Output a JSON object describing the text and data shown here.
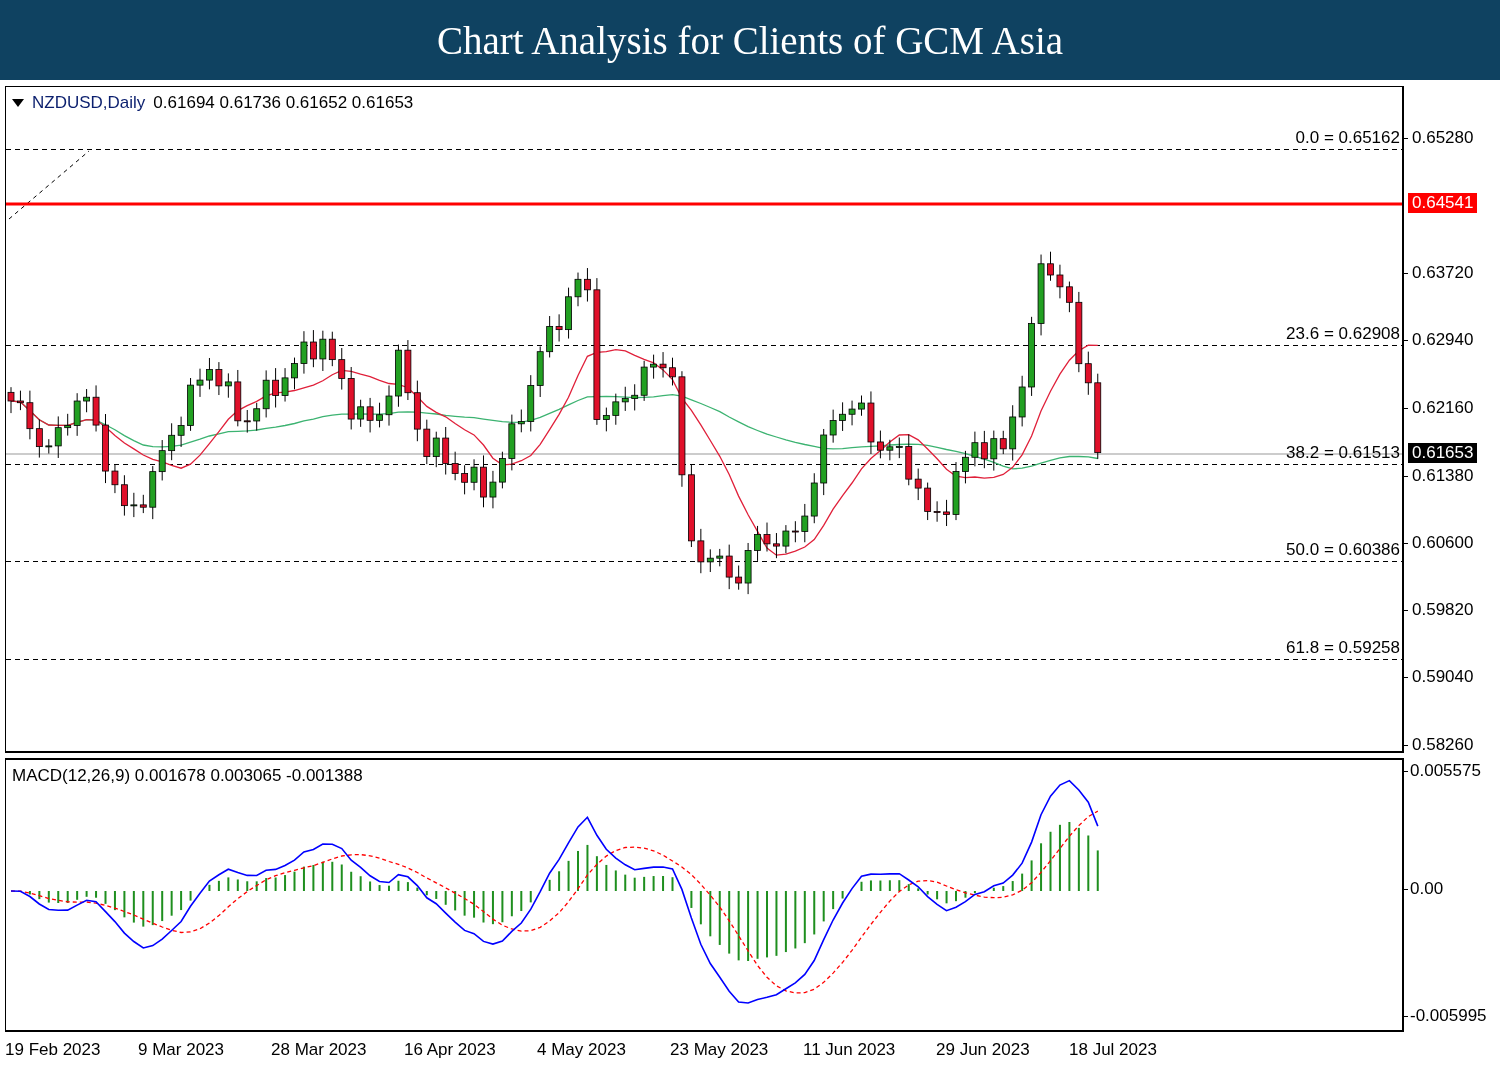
{
  "header": {
    "title": "Chart Analysis for Clients of GCM Asia"
  },
  "main_chart": {
    "symbol": "NZDUSD,Daily",
    "ohlc": "0.61694 0.61736 0.61652 0.61653",
    "fibonacci_levels": [
      {
        "label": "0.0 = 0.65162"
      },
      {
        "label": "23.6 = 0.62908"
      },
      {
        "label": "38.2 = 0.61513"
      },
      {
        "label": "50.0 = 0.60386"
      },
      {
        "label": "61.8 = 0.59258"
      }
    ],
    "price_axis": [
      "0.65280",
      "0.63720",
      "0.62940",
      "0.62160",
      "0.61380",
      "0.60600",
      "0.59820",
      "0.59040",
      "0.58260"
    ],
    "price_tags": [
      {
        "label": "0.64541",
        "kind": "alert"
      },
      {
        "label": "0.61653",
        "kind": "bid"
      }
    ]
  },
  "macd": {
    "legend": "MACD(12,26,9) 0.001678 0.003065 -0.001388",
    "axis": [
      "0.005575",
      "0.00",
      "-0.005995"
    ]
  },
  "time_axis": [
    "19 Feb 2023",
    "9 Mar 2023",
    "28 Mar 2023",
    "16 Apr 2023",
    "4 May 2023",
    "23 May 2023",
    "11 Jun 2023",
    "29 Jun 2023",
    "18 Jul 2023"
  ]
}
